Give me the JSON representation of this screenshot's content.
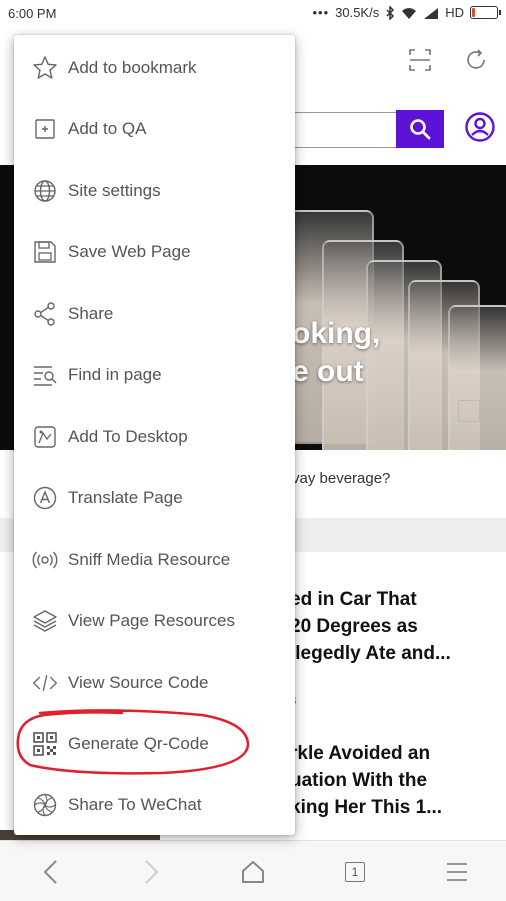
{
  "status_bar": {
    "time": "6:00 PM",
    "network_speed": "30.5K/s",
    "network_type": "HD",
    "icons": [
      "dots-icon",
      "bluetooth-icon",
      "wifi-icon",
      "signal-icon",
      "battery-icon"
    ],
    "battery_level": 0.15
  },
  "hero": {
    "title_line1": "oking,",
    "title_line2": "e out",
    "caption": "vay beverage?"
  },
  "articles": [
    {
      "lines": [
        "ed in Car That",
        "20 Degrees as",
        "llegedly Ate and..."
      ]
    },
    {
      "lines": [
        "rkle Avoided an",
        "uation With the",
        "king Her This 1..."
      ]
    }
  ],
  "article_tag": "s",
  "menu": {
    "items": [
      {
        "label": "Add to bookmark",
        "icon": "star-icon"
      },
      {
        "label": "Add to QA",
        "icon": "add-box-icon"
      },
      {
        "label": "Site settings",
        "icon": "globe-icon"
      },
      {
        "label": "Save Web Page",
        "icon": "save-icon"
      },
      {
        "label": "Share",
        "icon": "share-icon"
      },
      {
        "label": "Find in page",
        "icon": "find-icon"
      },
      {
        "label": "Add To Desktop",
        "icon": "desktop-add-icon"
      },
      {
        "label": "Translate Page",
        "icon": "translate-icon"
      },
      {
        "label": "Sniff Media Resource",
        "icon": "sniff-icon"
      },
      {
        "label": "View Page Resources",
        "icon": "layers-icon"
      },
      {
        "label": "View Source Code",
        "icon": "code-icon"
      },
      {
        "label": "Generate Qr-Code",
        "icon": "qr-code-icon"
      },
      {
        "label": "Share To WeChat",
        "icon": "wechat-icon"
      }
    ]
  },
  "bottom_nav": {
    "tab_count": "1",
    "icons": [
      "back-icon",
      "forward-icon",
      "home-icon",
      "tabs-icon",
      "menu-icon"
    ]
  },
  "colors": {
    "accent": "#5d12d8",
    "annotation": "#e0202a"
  }
}
